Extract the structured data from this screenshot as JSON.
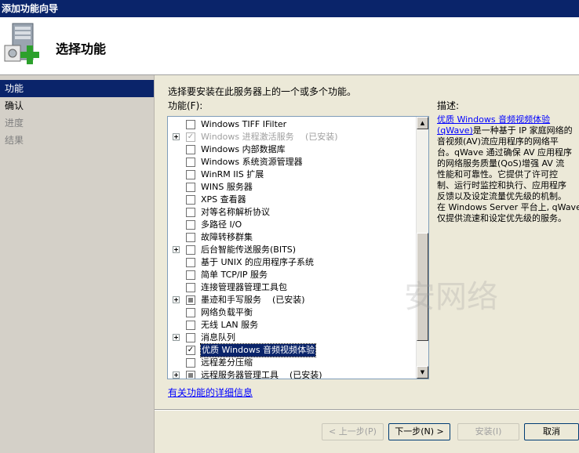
{
  "window": {
    "title": "添加功能向导"
  },
  "header": {
    "title": "选择功能"
  },
  "nav": {
    "items": [
      {
        "label": "功能",
        "state": "active"
      },
      {
        "label": "确认",
        "state": "enabled"
      },
      {
        "label": "进度",
        "state": "disabled"
      },
      {
        "label": "结果",
        "state": "disabled"
      }
    ]
  },
  "main": {
    "instruction": "选择要安装在此服务器上的一个或多个功能。",
    "features_label": "功能(F):",
    "more_info_link": "有关功能的详细信息",
    "features": [
      {
        "label": "Windows TIFF IFilter",
        "expander": false,
        "check": "unchecked",
        "status": ""
      },
      {
        "label": "Windows 进程激活服务",
        "expander": true,
        "check": "checked-disabled",
        "status": "(已安装)",
        "grey": true
      },
      {
        "label": "Windows 内部数据库",
        "expander": false,
        "check": "unchecked",
        "status": ""
      },
      {
        "label": "Windows 系统资源管理器",
        "expander": false,
        "check": "unchecked",
        "status": ""
      },
      {
        "label": "WinRM IIS 扩展",
        "expander": false,
        "check": "unchecked",
        "status": ""
      },
      {
        "label": "WINS 服务器",
        "expander": false,
        "check": "unchecked",
        "status": ""
      },
      {
        "label": "XPS 查看器",
        "expander": false,
        "check": "unchecked",
        "status": ""
      },
      {
        "label": "对等名称解析协议",
        "expander": false,
        "check": "unchecked",
        "status": ""
      },
      {
        "label": "多路径 I/O",
        "expander": false,
        "check": "unchecked",
        "status": ""
      },
      {
        "label": "故障转移群集",
        "expander": false,
        "check": "unchecked",
        "status": ""
      },
      {
        "label": "后台智能传送服务(BITS)",
        "expander": true,
        "check": "unchecked",
        "status": ""
      },
      {
        "label": "基于 UNIX 的应用程序子系统",
        "expander": false,
        "check": "unchecked",
        "status": ""
      },
      {
        "label": "简单 TCP/IP 服务",
        "expander": false,
        "check": "unchecked",
        "status": ""
      },
      {
        "label": "连接管理器管理工具包",
        "expander": false,
        "check": "unchecked",
        "status": ""
      },
      {
        "label": "墨迹和手写服务",
        "expander": true,
        "check": "partial",
        "status": "(已安装)"
      },
      {
        "label": "网络负载平衡",
        "expander": false,
        "check": "unchecked",
        "status": ""
      },
      {
        "label": "无线 LAN 服务",
        "expander": false,
        "check": "unchecked",
        "status": ""
      },
      {
        "label": "消息队列",
        "expander": true,
        "check": "unchecked",
        "status": ""
      },
      {
        "label": "优质 Windows 音频视频体验",
        "expander": false,
        "check": "checked",
        "status": "",
        "selected": true
      },
      {
        "label": "远程差分压缩",
        "expander": false,
        "check": "unchecked",
        "status": ""
      },
      {
        "label": "远程服务器管理工具",
        "expander": true,
        "check": "partial",
        "status": "(已安装)"
      }
    ]
  },
  "description": {
    "label": "描述:",
    "link1": "优质 Windows 音频视频体验",
    "link2": "(qWave)",
    "lines": [
      "是一种基于 IP 家庭网络的",
      "音视频(AV)流应用程序的网络平",
      "台。qWave 通过确保 AV 应用程序",
      "的网络服务质量(QoS)增强 AV 流",
      "性能和可靠性。它提供了许可控",
      "制、运行时监控和执行、应用程序",
      "反馈以及设定流量优先级的机制。",
      "在 Windows Server 平台上, qWave",
      "仅提供流速和设定优先级的服务。"
    ]
  },
  "buttons": {
    "previous": "< 上一步(P)",
    "next": "下一步(N) >",
    "install": "安装(I)",
    "cancel": "取消"
  },
  "watermark": "安网络"
}
